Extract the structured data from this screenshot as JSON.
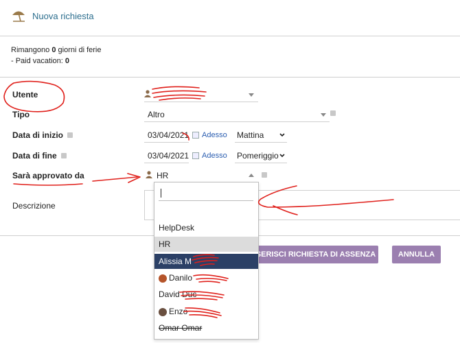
{
  "header": {
    "title": "Nuova richiesta",
    "icon": "beach-umbrella-icon"
  },
  "balance": {
    "line1_prefix": "Rimangono ",
    "line1_value": "0",
    "line1_suffix": " giorni di ferie",
    "line2_prefix": "- Paid vacation: ",
    "line2_value": "0"
  },
  "form": {
    "utente": {
      "label": "Utente"
    },
    "tipo": {
      "label": "Tipo",
      "value": "Altro"
    },
    "data_inizio": {
      "label": "Data di inizio",
      "date": "03/04/2021",
      "now_link": "Adesso",
      "period": "Mattina"
    },
    "data_fine": {
      "label": "Data di fine",
      "date": "03/04/2021",
      "now_link": "Adesso",
      "period": "Pomeriggio"
    },
    "approver": {
      "label": "Sarà approvato da",
      "value": "HR"
    },
    "descrizione": {
      "label": "Descrizione"
    }
  },
  "dropdown": {
    "search_value": "",
    "items": [
      {
        "label": "HelpDesk",
        "state": "normal"
      },
      {
        "label": "HR",
        "state": "selected"
      },
      {
        "label": "Alissia M",
        "state": "highlighted"
      },
      {
        "label": "Danilo",
        "state": "normal",
        "avatar": true
      },
      {
        "label": "David Duc",
        "state": "normal"
      },
      {
        "label": "Enzo",
        "state": "normal",
        "avatar": true
      },
      {
        "label": "Omar Omar",
        "state": "normal"
      }
    ]
  },
  "actions": {
    "submit_label": "INSERISCI RICHIESTA DI ASSENZA",
    "cancel_label": "ANNULLA"
  },
  "colors": {
    "title": "#2c6e8e",
    "button": "#9b7fb0",
    "highlight": "#2b4066",
    "selected_bg": "#dcdcdc",
    "annotation": "#e0201b"
  }
}
